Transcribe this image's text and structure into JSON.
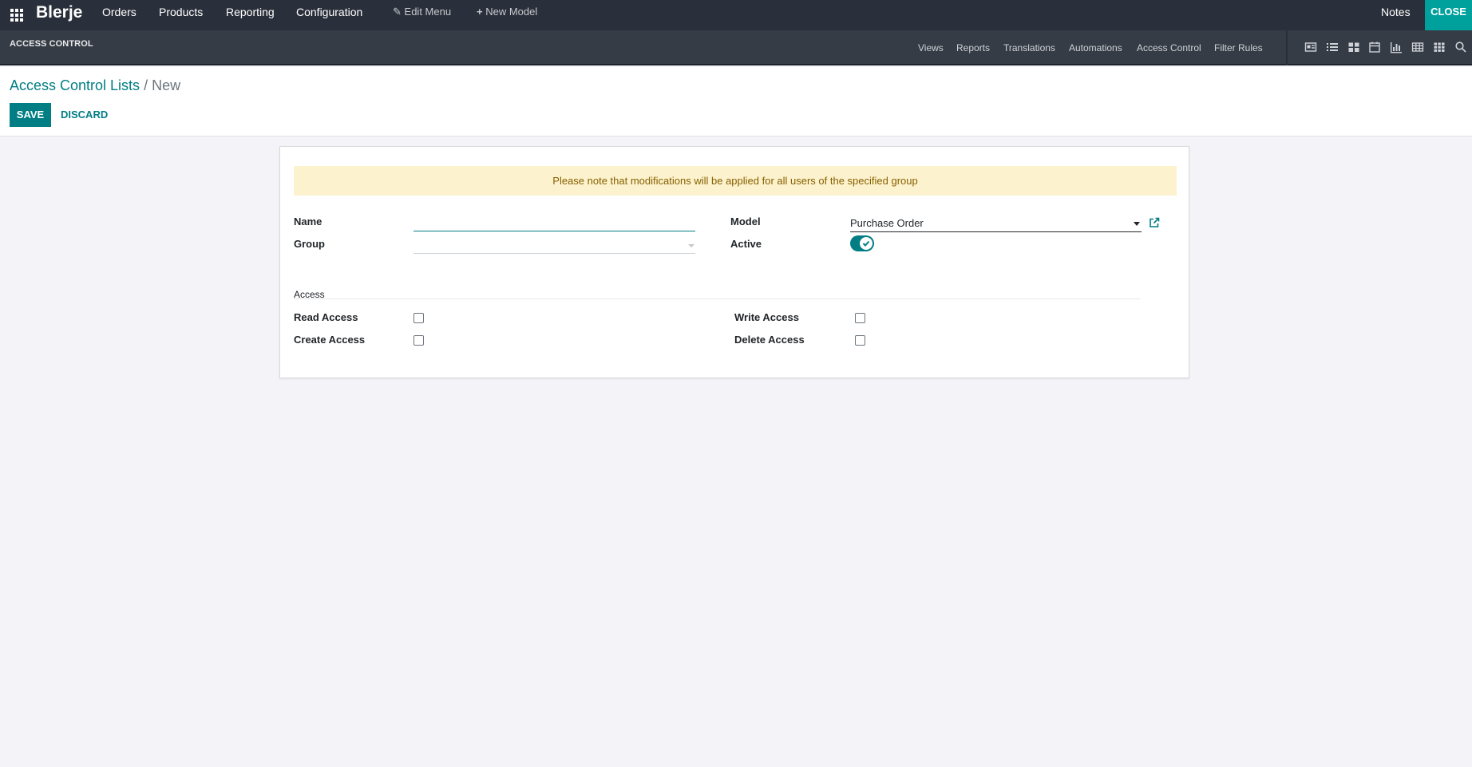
{
  "topbar": {
    "brand": "Blerje",
    "menu": [
      "Orders",
      "Products",
      "Reporting",
      "Configuration"
    ],
    "edit_menu": "Edit Menu",
    "new_model": "New Model",
    "notes": "Notes",
    "close": "CLOSE"
  },
  "subbar": {
    "title": "ACCESS CONTROL",
    "tabs": [
      "Views",
      "Reports",
      "Translations",
      "Automations",
      "Access Control",
      "Filter Rules"
    ],
    "view_icons": [
      "form-view-icon",
      "list-view-icon",
      "kanban-view-icon",
      "calendar-view-icon",
      "graph-view-icon",
      "pivot-view-icon",
      "grid-view-icon",
      "search-view-icon"
    ]
  },
  "breadcrumb": {
    "parent": "Access Control Lists",
    "separator": " / ",
    "current": "New"
  },
  "buttons": {
    "save": "SAVE",
    "discard": "DISCARD"
  },
  "form": {
    "alert": "Please note that modifications will be applied for all users of the specified group",
    "name_label": "Name",
    "name_value": "",
    "group_label": "Group",
    "group_value": "",
    "model_label": "Model",
    "model_value": "Purchase Order",
    "active_label": "Active",
    "active": true,
    "access_section": "Access",
    "read_label": "Read Access",
    "write_label": "Write Access",
    "create_label": "Create Access",
    "delete_label": "Delete Access",
    "read": false,
    "write": false,
    "create": false,
    "delete": false
  },
  "colors": {
    "accent": "#017e84",
    "topbar": "#2a303b",
    "close_button": "#00a09d",
    "alert_bg": "#fcf2cd",
    "alert_text": "#876000"
  }
}
